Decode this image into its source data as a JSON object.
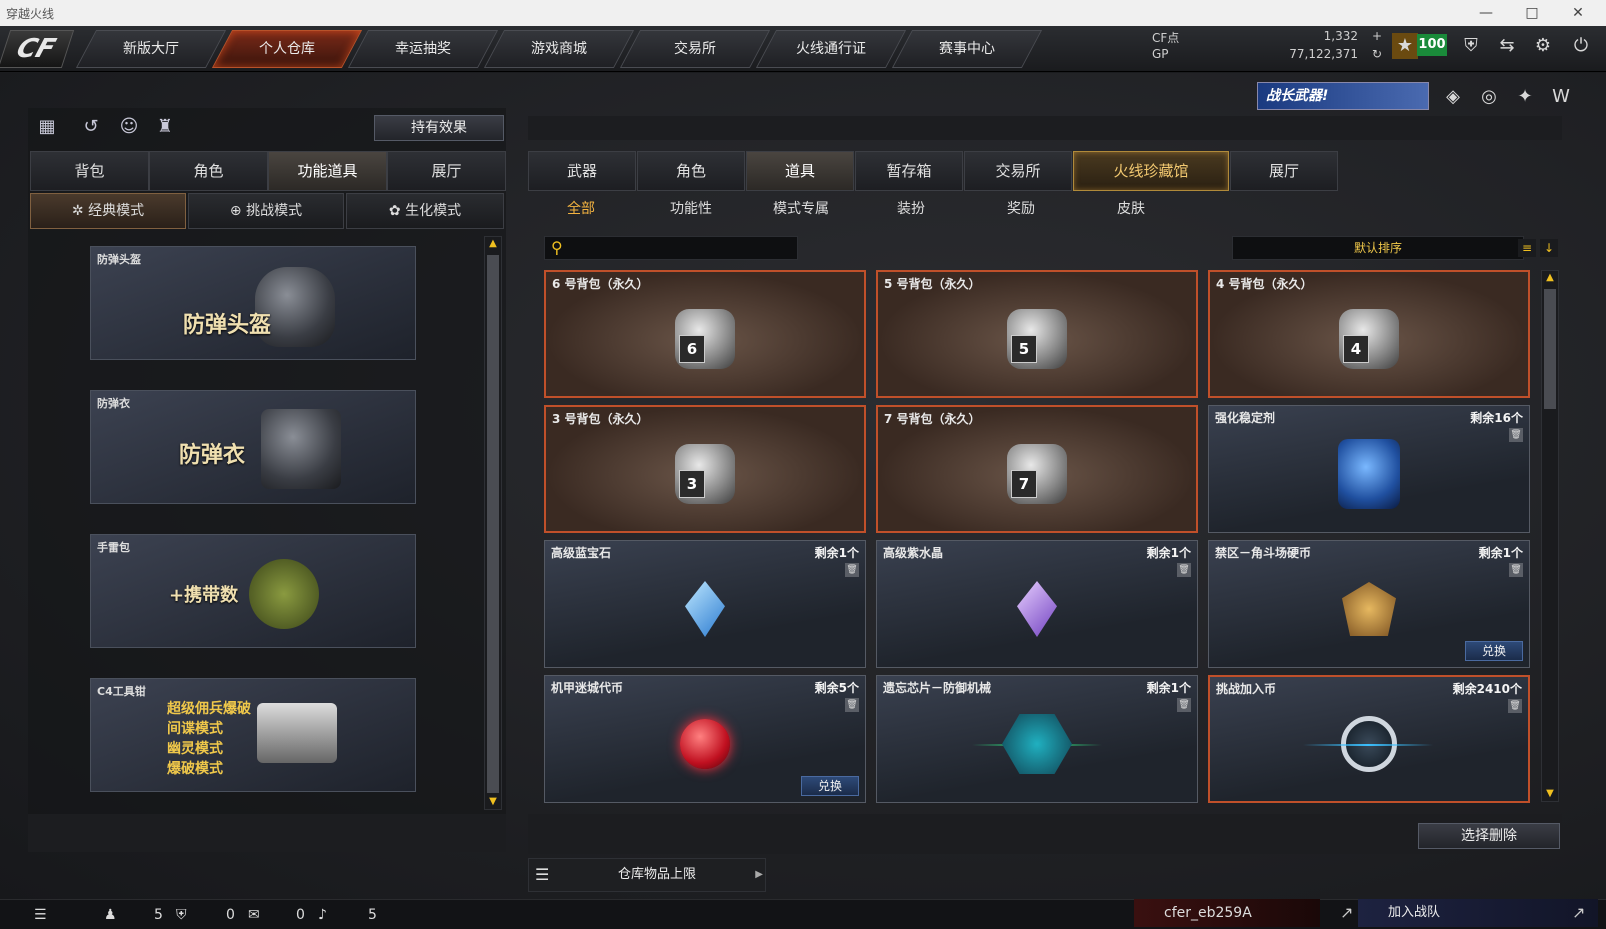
{
  "window": {
    "title": "穿越火线",
    "minimize": "—",
    "maximize": "□",
    "close": "✕"
  },
  "logo": "CF",
  "nav": {
    "tabs": [
      "新版大厅",
      "个人仓库",
      "幸运抽奖",
      "游戏商城",
      "交易所",
      "火线通行证",
      "赛事中心"
    ],
    "active_index": 1
  },
  "currency": {
    "cf_label": "CF点",
    "cf_value": "1,332",
    "cf_plus": "+",
    "gp_label": "GP",
    "gp_value": "77,122,371",
    "gp_refresh": "↻"
  },
  "level_badge": "100",
  "top_icons": [
    "shield-icon",
    "exchange-icon",
    "gear-icon",
    "power-icon"
  ],
  "banner": {
    "text": "战长武器!",
    "icons": [
      "badge-v-icon",
      "globe-icon",
      "sparkle-icon",
      "wings-icon"
    ]
  },
  "left": {
    "icon_buttons": [
      "ranking-icon",
      "history-icon",
      "character-icon",
      "bag-icon"
    ],
    "effect_button": "持有效果",
    "tabs": [
      "背包",
      "角色",
      "功能道具",
      "展厅"
    ],
    "active_tab": 2,
    "modes": [
      "经典模式",
      "挑战模式",
      "生化模式"
    ],
    "mode_icons": [
      "✲",
      "⊕",
      "✿"
    ],
    "active_mode": 0,
    "cards": [
      {
        "caption": "防弹头盔",
        "text": "防弹头盔"
      },
      {
        "caption": "防弹衣",
        "text": "防弹衣"
      },
      {
        "caption": "手雷包",
        "text": "+携带数"
      },
      {
        "caption": "C4工具钳",
        "lines": [
          "超级佣兵爆破",
          "间谍模式",
          "幽灵模式",
          "爆破模式"
        ]
      }
    ]
  },
  "right": {
    "tabs": [
      "武器",
      "角色",
      "道具",
      "暂存箱",
      "交易所",
      "火线珍藏馆",
      "展厅"
    ],
    "active_tab": 2,
    "gold_tab": 5,
    "filters": [
      "全部",
      "功能性",
      "模式专属",
      "装扮",
      "奖励",
      "皮肤"
    ],
    "active_filter": 0,
    "search_placeholder": "",
    "sort_label": "默认排序",
    "items": [
      {
        "name": "6 号背包（永久）",
        "kind": "bag",
        "num": "6"
      },
      {
        "name": "5 号背包（永久）",
        "kind": "bag",
        "num": "5"
      },
      {
        "name": "4 号背包（永久）",
        "kind": "bag",
        "num": "4"
      },
      {
        "name": "3 号背包（永久）",
        "kind": "bag",
        "num": "3"
      },
      {
        "name": "7 号背包（永久）",
        "kind": "bag",
        "num": "7"
      },
      {
        "name": "强化稳定剂",
        "count": "剩余16个",
        "kind": "jar"
      },
      {
        "name": "高级蓝宝石",
        "count": "剩余1个",
        "kind": "gem-blue"
      },
      {
        "name": "高级紫水晶",
        "count": "剩余1个",
        "kind": "gem-purple"
      },
      {
        "name": "禁区－角斗场硬币",
        "count": "剩余1个",
        "kind": "emblem",
        "exchange": "兑换"
      },
      {
        "name": "机甲迷城代币",
        "count": "剩余5个",
        "kind": "orb",
        "exchange": "兑换"
      },
      {
        "name": "遗忘芯片－防御机械",
        "count": "剩余1个",
        "kind": "hex"
      },
      {
        "name": "挑战加入币",
        "count": "剩余2410个",
        "kind": "ring",
        "red": true
      }
    ],
    "select_delete": "选择删除",
    "capacity_label": "仓库物品上限"
  },
  "status": {
    "friends": "5",
    "clan": "0",
    "chat": "0",
    "volume": "5",
    "player": "cfer_eb259A",
    "join_team": "加入战队"
  },
  "colors": {
    "accent_orange": "#c0502a",
    "gold": "#f3b340",
    "level_green": "#1a8a3a"
  }
}
